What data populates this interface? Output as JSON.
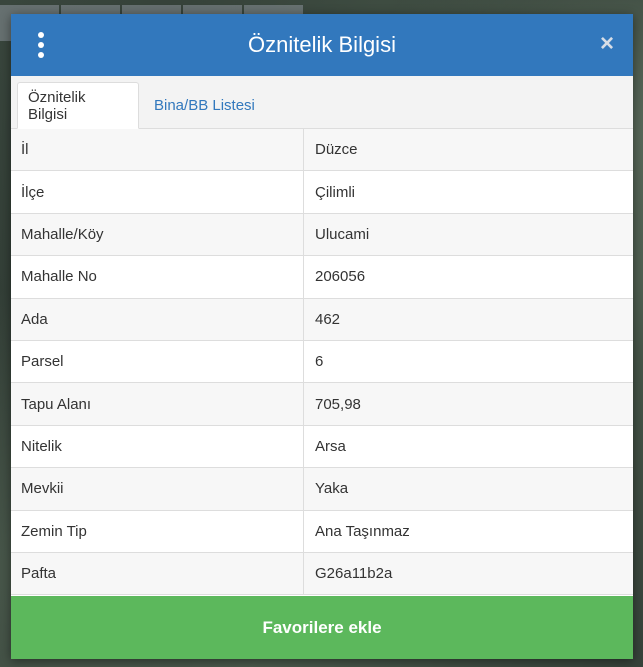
{
  "dialog": {
    "title": "Öznitelik Bilgisi",
    "close_icon": "×"
  },
  "tabs": [
    {
      "label": "Öznitelik Bilgisi",
      "active": true
    },
    {
      "label": "Bina/BB Listesi",
      "active": false
    }
  ],
  "attributes": [
    {
      "key": "İl",
      "value": "Düzce"
    },
    {
      "key": "İlçe",
      "value": "Çilimli"
    },
    {
      "key": "Mahalle/Köy",
      "value": "Ulucami"
    },
    {
      "key": "Mahalle No",
      "value": "206056"
    },
    {
      "key": "Ada",
      "value": "462"
    },
    {
      "key": "Parsel",
      "value": "6"
    },
    {
      "key": "Tapu Alanı",
      "value": "705,98"
    },
    {
      "key": "Nitelik",
      "value": "Arsa"
    },
    {
      "key": "Mevkii",
      "value": "Yaka"
    },
    {
      "key": "Zemin Tip",
      "value": "Ana Taşınmaz"
    },
    {
      "key": "Pafta",
      "value": "G26a11b2a"
    }
  ],
  "footer": {
    "button_label": "Favorilere ekle"
  },
  "colors": {
    "header": "#3278bd",
    "footer_button": "#5cb85c",
    "tab_link": "#3278bd"
  },
  "icons": {
    "menu": "vertical-ellipsis-icon",
    "close": "close-icon"
  }
}
